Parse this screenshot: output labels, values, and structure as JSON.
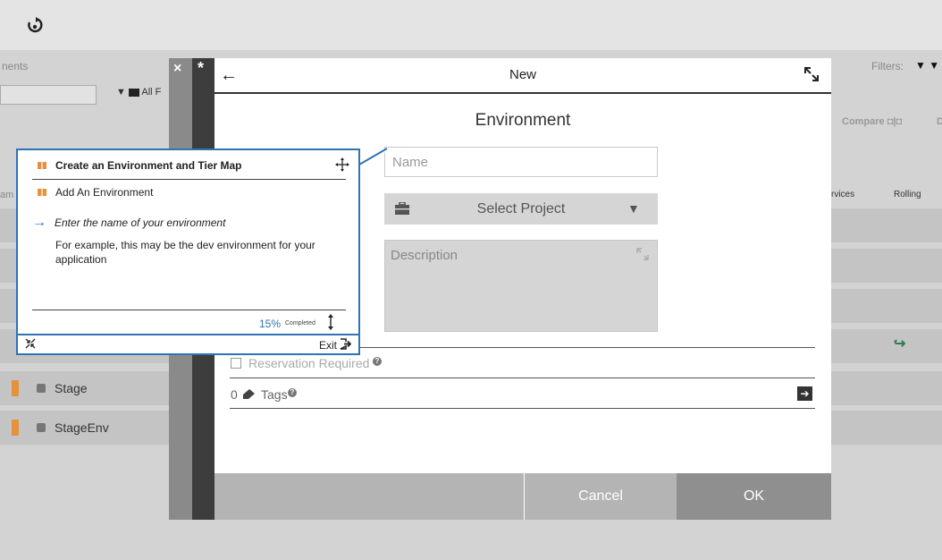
{
  "topbar": {
    "refresh_icon": "refresh-icon"
  },
  "background": {
    "breadcrumb": "nents",
    "filter_label": "All F",
    "filters_label": "Filters:",
    "compare_label": "Compare",
    "compare_extra": "D",
    "col_am": "am",
    "col_services": "rvices",
    "col_rolling": "Rolling",
    "rows": [
      {
        "label": "Stage"
      },
      {
        "label": "StageEnv"
      }
    ]
  },
  "modal": {
    "close": "×",
    "star": "*",
    "title": "New",
    "heading": "Environment",
    "name_placeholder": "Name",
    "project_label": "Select Project",
    "description_label": "Description",
    "reservation_label": "Reservation Required",
    "tags_count": "0",
    "tags_label": "Tags",
    "cancel_label": "Cancel",
    "ok_label": "OK"
  },
  "tour": {
    "title": "Create an Environment and Tier Map",
    "subtitle": "Add An Environment",
    "step": "Enter the name of your environment",
    "body": "For example, this may be the dev environment for your application",
    "percent": "15%",
    "completed": "Completed",
    "exit_label": "Exit"
  },
  "colors": {
    "accent": "#2d74b4",
    "orange": "#e5913e",
    "green": "#2e7d4f"
  }
}
